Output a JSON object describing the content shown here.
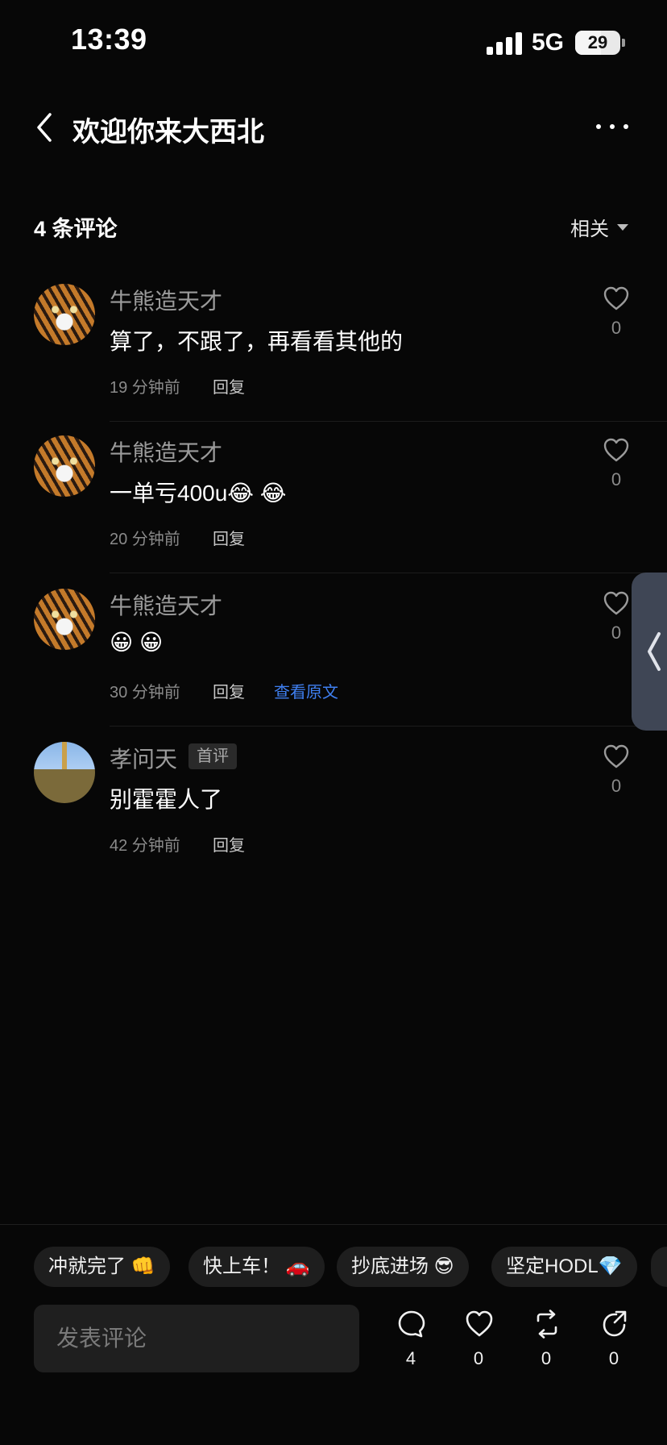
{
  "status_bar": {
    "time": "13:39",
    "network": "5G",
    "battery": "29"
  },
  "header": {
    "title": "欢迎你来大西北"
  },
  "comments_section": {
    "title": "4 条评论",
    "sort_label": "相关",
    "comments": [
      {
        "user": "牛熊造天才",
        "text": "算了，不跟了，再看看其他的",
        "time": "19 分钟前",
        "reply": "回复",
        "likes": "0"
      },
      {
        "user": "牛熊造天才",
        "text": "一单亏400u😂 😂",
        "time": "20 分钟前",
        "reply": "回复",
        "likes": "0"
      },
      {
        "user": "牛熊造天才",
        "text": "😀  😀",
        "time": "30 分钟前",
        "reply": "回复",
        "view_original": "查看原文",
        "likes": "0"
      },
      {
        "user": "孝问天",
        "badge": "首评",
        "text": "别霍霍人了",
        "time": "42 分钟前",
        "reply": "回复",
        "likes": "0"
      }
    ]
  },
  "quick_replies": [
    "冲就完了 👊",
    "快上车！ 🚗",
    "抄底进场 😎",
    "坚定HODL💎"
  ],
  "composer": {
    "placeholder": "发表评论"
  },
  "actions": {
    "comments": "4",
    "likes": "0",
    "reposts": "0",
    "shares": "0"
  },
  "colors": {
    "background": "#070707",
    "link": "#3f7ff0",
    "chip_bg": "#1e1e1e",
    "drawer_tab": "#3f4655"
  }
}
